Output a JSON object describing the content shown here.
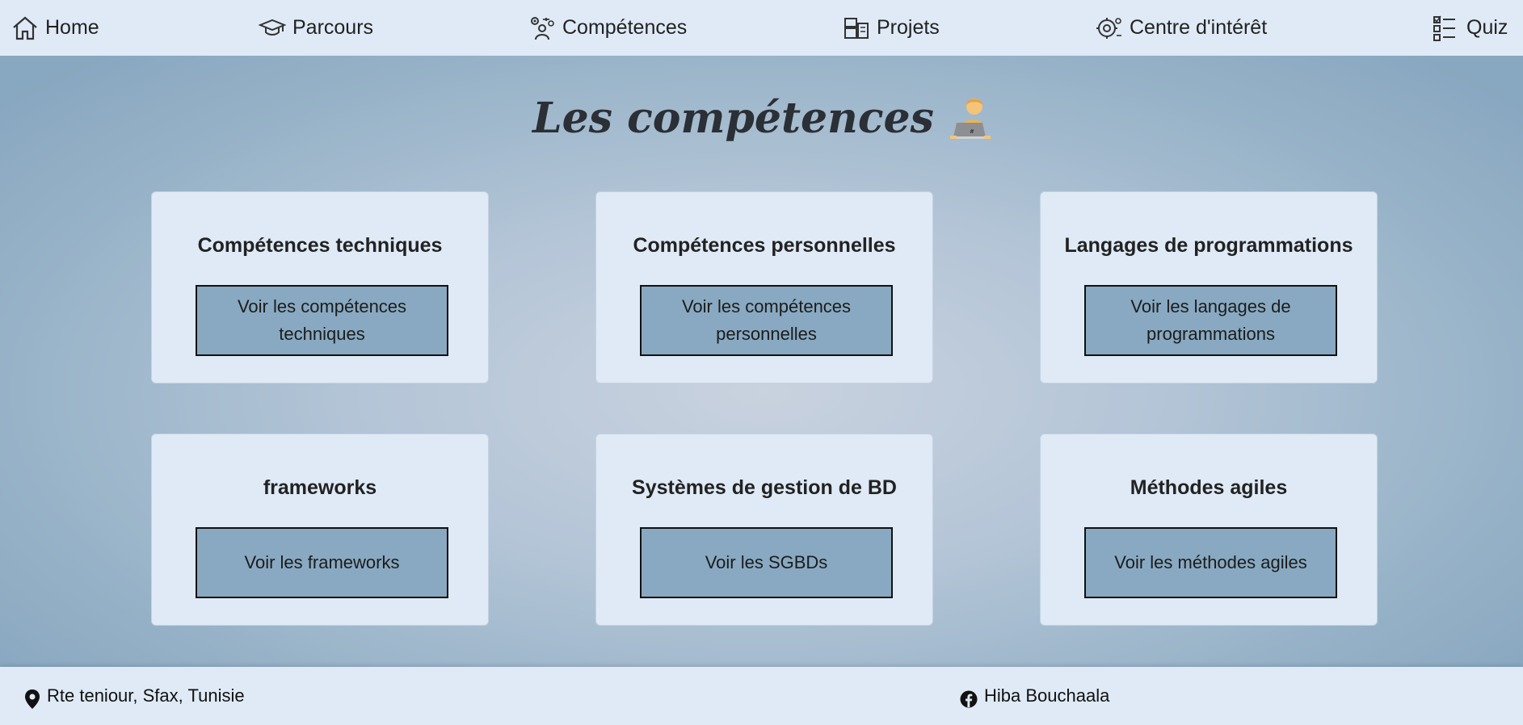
{
  "nav": {
    "items": [
      {
        "label": "Home",
        "icon": "home-icon"
      },
      {
        "label": "Parcours",
        "icon": "graduation-cap-icon"
      },
      {
        "label": "Compétences",
        "icon": "skills-gear-person-icon"
      },
      {
        "label": "Projets",
        "icon": "projects-icon"
      },
      {
        "label": "Centre d'intérêt",
        "icon": "interests-icon"
      },
      {
        "label": "Quiz",
        "icon": "checklist-icon"
      }
    ]
  },
  "main": {
    "title": "Les compétences",
    "title_emoji": "technologist-emoji",
    "cards": [
      {
        "title": "Compétences techniques",
        "button": "Voir les compétences techniques"
      },
      {
        "title": "Compétences personnelles",
        "button": "Voir les compétences personnelles"
      },
      {
        "title": "Langages de programmations",
        "button": "Voir les langages de programmations"
      },
      {
        "title": "frameworks",
        "button": "Voir les frameworks"
      },
      {
        "title": "Systèmes de gestion de BD",
        "button": "Voir les SGBDs"
      },
      {
        "title": "Méthodes agiles",
        "button": "Voir les méthodes agiles"
      }
    ]
  },
  "footer": {
    "address": "Rte teniour, Sfax, Tunisie",
    "address_icon": "map-pin-icon",
    "social": "Hiba Bouchaala",
    "social_icon": "facebook-icon"
  },
  "colors": {
    "nav_bg": "#dfeaf6",
    "card_bg": "#dfeaf6",
    "button_bg": "#88a9c1",
    "background_center": "#c9d2df",
    "background_edge": "#88a7c0"
  }
}
